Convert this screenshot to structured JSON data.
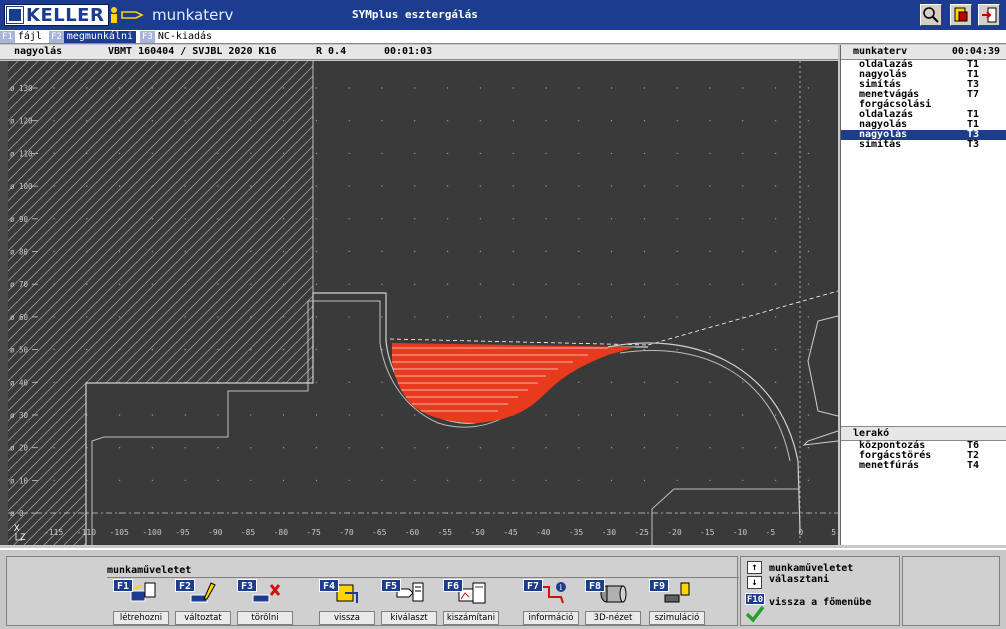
{
  "titlebar": {
    "logo": "KELLER",
    "mode_label": "munkaterv",
    "app_title": "SYMplus esztergálás"
  },
  "menu": [
    {
      "key": "F1",
      "label": "fájl"
    },
    {
      "key": "F2",
      "label": "megmunkálni"
    },
    {
      "key": "F3",
      "label": "NC-kiadás"
    }
  ],
  "status": {
    "operation": "nagyolás",
    "tool": "VBMT 160404 / SVJBL 2020 K16",
    "radius": "R 0.4",
    "time": "00:01:03"
  },
  "plan": {
    "title": "munkaterv",
    "time": "00:04:39",
    "rows": [
      {
        "name": "oldalazás",
        "tool": "T1"
      },
      {
        "name": "nagyolás",
        "tool": "T1"
      },
      {
        "name": "simítás",
        "tool": "T3"
      },
      {
        "name": "menetvágás",
        "tool": "T7"
      },
      {
        "name": "forgácsolási",
        "tool": ""
      },
      {
        "name": "oldalazás",
        "tool": "T1"
      },
      {
        "name": "nagyolás",
        "tool": "T1"
      },
      {
        "name": "nagyolás",
        "tool": "T3"
      },
      {
        "name": "simítás",
        "tool": "T3"
      }
    ],
    "selected_index": 7
  },
  "storage": {
    "title": "lerakó",
    "rows": [
      {
        "name": "központozás",
        "tool": "T6"
      },
      {
        "name": "forgácstörés",
        "tool": "T2"
      },
      {
        "name": "menetfúrás",
        "tool": "T4"
      }
    ]
  },
  "canvas": {
    "x_ticks": [
      "-115",
      "-110",
      "-105",
      "-100",
      "-95",
      "-90",
      "-85",
      "-80",
      "-75",
      "-70",
      "-65",
      "-60",
      "-55",
      "-50",
      "-45",
      "-40",
      "-35",
      "-30",
      "-25",
      "-20",
      "-15",
      "-10",
      "-5",
      "0",
      "5"
    ],
    "y_ticks": [
      "ø 130",
      "ø 120",
      "ø 110",
      "ø 100",
      "ø 90",
      "ø 80",
      "ø 70",
      "ø 60",
      "ø 50",
      "ø 40",
      "ø 30",
      "ø 20",
      "ø 10",
      "ø 0"
    ],
    "axis_x": "X",
    "axis_z": "Z",
    "colors": {
      "background": "#3a3a3a",
      "cut_area": "#e83a1c",
      "contour": "#d8d8d8"
    }
  },
  "toolbar": {
    "group_label": "munkaműveletet",
    "buttons": [
      {
        "key": "F1",
        "label": "létrehozni",
        "icon": "create-icon"
      },
      {
        "key": "F2",
        "label": "változtat",
        "icon": "edit-icon"
      },
      {
        "key": "F3",
        "label": "törölni",
        "icon": "delete-icon"
      },
      {
        "key": "F4",
        "label": "vissza",
        "icon": "undo-icon"
      },
      {
        "key": "F5",
        "label": "kiválaszt",
        "icon": "select-icon"
      },
      {
        "key": "F6",
        "label": "kiszámítani",
        "icon": "calculate-icon"
      },
      {
        "key": "F7",
        "label": "információ",
        "icon": "info-icon"
      },
      {
        "key": "F8",
        "label": "3D-nézet",
        "icon": "3d-view-icon"
      },
      {
        "key": "F9",
        "label": "szimuláció",
        "icon": "simulation-icon"
      }
    ],
    "nav_select": "munkaműveletet választani",
    "f10_key": "F10",
    "f10_label": "vissza a főmenübe"
  }
}
